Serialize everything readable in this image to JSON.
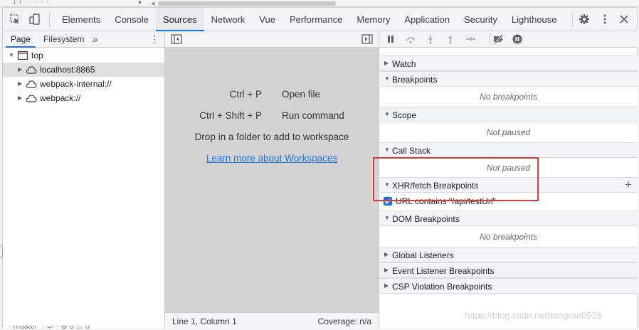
{
  "toolbar": {
    "tabs": [
      "Elements",
      "Console",
      "Sources",
      "Network",
      "Vue",
      "Performance",
      "Memory",
      "Application",
      "Security",
      "Lighthouse"
    ],
    "active_tab": "Sources",
    "icons": [
      "inspect-icon",
      "device-toggle-icon",
      "gear-icon",
      "kebab-menu-icon",
      "close-icon"
    ]
  },
  "navigator": {
    "tabs": [
      "Page",
      "Filesystem"
    ],
    "more": "»",
    "tree": [
      {
        "label": "top",
        "icon": "frame-icon",
        "expanded": true
      },
      {
        "label": "localhost:8865",
        "icon": "cloud-icon",
        "selected": true
      },
      {
        "label": "webpack-internal://",
        "icon": "cloud-icon"
      },
      {
        "label": "webpack://",
        "icon": "cloud-icon"
      }
    ]
  },
  "editor": {
    "shortcuts": [
      {
        "keys": "Ctrl + P",
        "action": "Open file"
      },
      {
        "keys": "Ctrl + Shift + P",
        "action": "Run command"
      }
    ],
    "workspace_hint": "Drop in a folder to add to workspace",
    "workspace_link": "Learn more about Workspaces",
    "status": {
      "position": "Line 1, Column 1",
      "coverage": "Coverage: n/a"
    }
  },
  "debugger": {
    "controls": [
      "pause-icon",
      "step-over-icon",
      "step-into-icon",
      "step-out-icon",
      "step-icon",
      "deactivate-breakpoints-icon",
      "pause-on-exceptions-icon"
    ],
    "sections": {
      "watch": {
        "title": "Watch"
      },
      "breakpoints": {
        "title": "Breakpoints",
        "empty": "No breakpoints"
      },
      "scope": {
        "title": "Scope",
        "empty": "Not paused"
      },
      "call_stack": {
        "title": "Call Stack",
        "empty": "Not paused"
      },
      "xhr": {
        "title": "XHR/fetch Breakpoints",
        "add": "+",
        "item": "URL contains \"/api/testUrl\"",
        "checked": true
      },
      "dom": {
        "title": "DOM Breakpoints",
        "empty": "No breakpoints"
      },
      "global": {
        "title": "Global Listeners"
      },
      "event": {
        "title": "Event Listener Breakpoints"
      },
      "csp": {
        "title": "CSP Violation Breakpoints"
      }
    }
  },
  "watermark": "https://blog.csdn.net/tangran0526",
  "colors": {
    "accent": "#1a73e8",
    "highlight": "#e53935",
    "editor_bg": "#d3d3d3"
  }
}
